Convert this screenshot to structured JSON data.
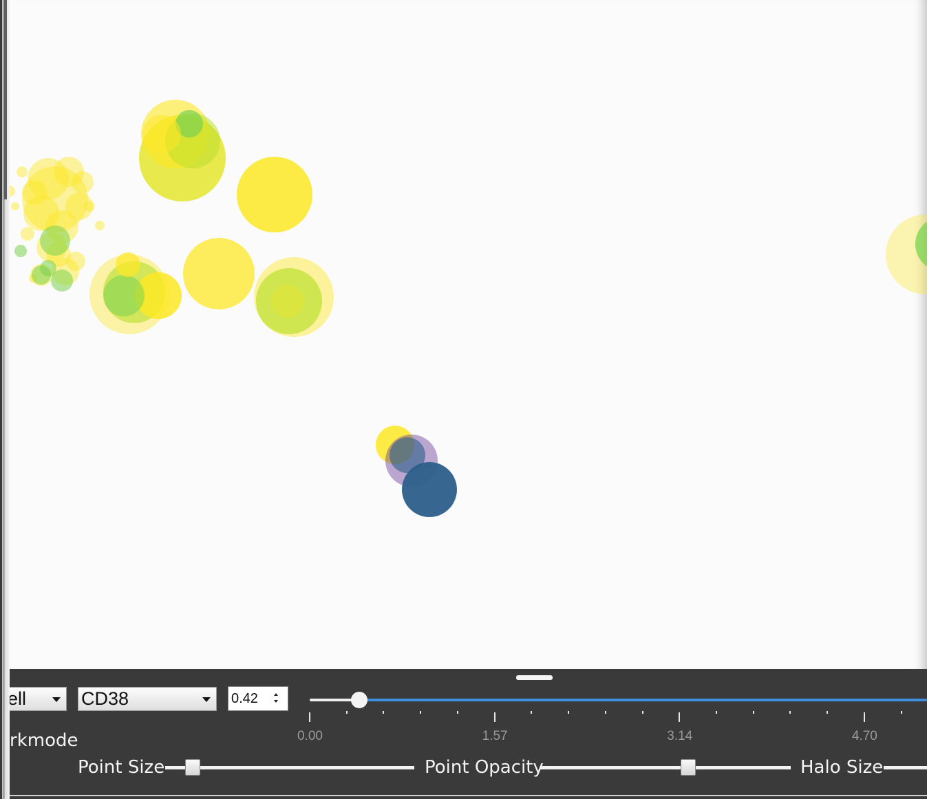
{
  "controls": {
    "cell_dropdown": "ell",
    "marker_dropdown": "CD38",
    "threshold_value": "0.42",
    "darkmode_label": "rkmode",
    "threshold_slider": {
      "value": 0.42,
      "min": 0.0,
      "max": 6.27,
      "tick_labels": [
        "0.00",
        "1.57",
        "3.14",
        "4.70"
      ]
    },
    "point_size_label": "Point Size",
    "point_size_level": 0.11,
    "point_opacity_label": "Point Opacity",
    "point_opacity_level": 0.59,
    "halo_size_label": "Halo Size"
  },
  "colors": {
    "panel_bg": "#3a3a3a",
    "slider_accent": "#3d8fe0",
    "canvas_bg": "#fbfbfb",
    "point_yellow": "#fde725",
    "point_green": "#7ad151",
    "point_navy": "#2c5f8a"
  }
}
